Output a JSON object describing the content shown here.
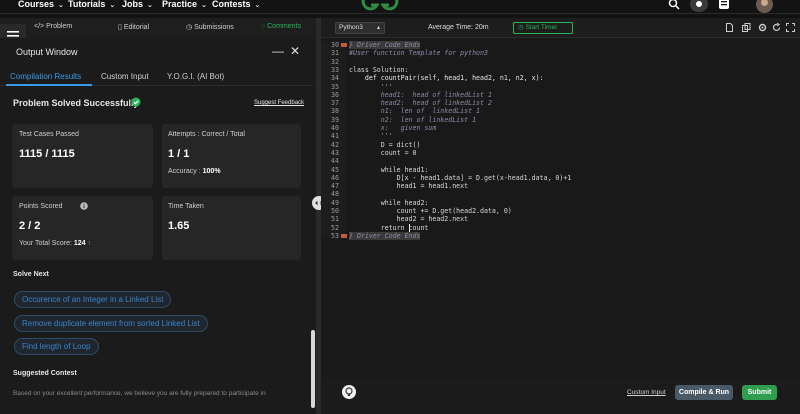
{
  "topnav": {
    "items": [
      {
        "label": "Courses",
        "chevron": "⌄"
      },
      {
        "label": "Tutorials",
        "chevron": "⌄"
      },
      {
        "label": "Jobs",
        "chevron": "⌄"
      },
      {
        "label": "Practice",
        "chevron": "⌄"
      },
      {
        "label": "Contests",
        "chevron": "⌄"
      }
    ]
  },
  "left_tabs": [
    {
      "label": "Problem",
      "icon": "code-icon"
    },
    {
      "label": "Editorial",
      "icon": "book-icon"
    },
    {
      "label": "Submissions",
      "icon": "clock-icon"
    },
    {
      "label": "Comments",
      "icon": "comment-icon"
    }
  ],
  "output": {
    "title": "Output Window",
    "tabs": [
      "Compilation Results",
      "Custom Input",
      "Y.O.G.I. (AI Bot)"
    ],
    "status": "Problem Solved Successfully",
    "suggest_feedback": "Suggest Feedback",
    "test_cases_label": "Test Cases Passed",
    "test_cases_value": "1115 / 1115",
    "attempts_label": "Attempts : Correct / Total",
    "attempts_value": "1 / 1",
    "accuracy_label": "Accuracy :",
    "accuracy_value": "100%",
    "points_label": "Points Scored",
    "points_value": "2 / 2",
    "total_score_label": "Your Total Score:",
    "total_score_value": "124",
    "time_label": "Time Taken",
    "time_value": "1.65",
    "solve_next_title": "Solve Next",
    "solve_next": [
      "Occurence of an Integer in a Linked List",
      "Remove duplicate element from sorted Linked List",
      "Find length of Loop"
    ],
    "suggested_contest_title": "Suggested Contest",
    "suggested_contest_text": "Based on your excellent performance, we believe you are fully prepared to participate in"
  },
  "editor": {
    "language": "Python3",
    "average_time": "Average Time: 20m",
    "start_timer": "Start Timer",
    "code_lines": [
      {
        "n": "30",
        "text": "} Driver Code Ends",
        "cls": "cm",
        "fold": true
      },
      {
        "n": "31",
        "text": "#User function Template for python3",
        "cls": "cm"
      },
      {
        "n": "32",
        "text": "",
        "cls": "kw"
      },
      {
        "n": "33",
        "text": "class Solution:",
        "cls": "kw"
      },
      {
        "n": "34",
        "text": "    def countPair(self, head1, head2, n1, n2, x):",
        "cls": "def"
      },
      {
        "n": "35",
        "text": "        '''",
        "cls": "str"
      },
      {
        "n": "36",
        "text": "        head1:  head of linkedList 1",
        "cls": "cm"
      },
      {
        "n": "37",
        "text": "        head2:  head of linkedList 2",
        "cls": "cm"
      },
      {
        "n": "38",
        "text": "        n1:  len of  linkedList 1",
        "cls": "cm"
      },
      {
        "n": "39",
        "text": "        n2:  len of linkedList 1",
        "cls": "cm"
      },
      {
        "n": "40",
        "text": "        x:   given sum",
        "cls": "cm"
      },
      {
        "n": "41",
        "text": "        '''",
        "cls": "str"
      },
      {
        "n": "42",
        "text": "        D = dict()",
        "cls": "kw"
      },
      {
        "n": "43",
        "text": "        count = 0",
        "cls": "kw"
      },
      {
        "n": "44",
        "text": "",
        "cls": "kw"
      },
      {
        "n": "45",
        "text": "        while head1:",
        "cls": "kw"
      },
      {
        "n": "46",
        "text": "            D[x - head1.data] = D.get(x-head1.data, 0)+1",
        "cls": "kw"
      },
      {
        "n": "47",
        "text": "            head1 = head1.next",
        "cls": "kw"
      },
      {
        "n": "48",
        "text": "",
        "cls": "kw"
      },
      {
        "n": "49",
        "text": "        while head2:",
        "cls": "kw"
      },
      {
        "n": "50",
        "text": "            count += D.get(head2.data, 0)",
        "cls": "kw"
      },
      {
        "n": "51",
        "text": "            head2 = head2.next",
        "cls": "kw"
      },
      {
        "n": "52",
        "text": "        return count",
        "cls": "kw"
      },
      {
        "n": "53",
        "text": "} Driver Code Ends",
        "cls": "cm",
        "fold": true
      }
    ],
    "custom_input": "Custom Input",
    "compile_run": "Compile & Run",
    "submit": "Submit"
  },
  "colors": {
    "accent_green": "#2bb45a",
    "link_blue": "#3b82c8",
    "submit_green": "#2f9e4f",
    "compile_gray": "#4a5966"
  }
}
